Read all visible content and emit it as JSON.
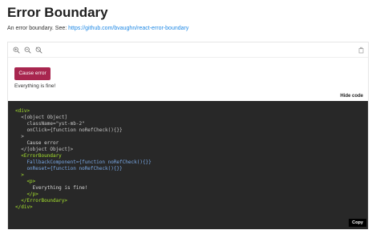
{
  "page": {
    "title": "Error Boundary",
    "description_prefix": "An error boundary. See:",
    "description_link": "https://github.com/bvaughn/react-error-boundary"
  },
  "toolbar": {
    "zoom_in_icon": "zoom-in-icon",
    "zoom_out_icon": "zoom-out-icon",
    "reset_zoom_icon": "zoom-reset-icon",
    "copy_icon": "copy-icon"
  },
  "preview": {
    "cause_error_label": "Cause error",
    "status_text": "Everything is fine!"
  },
  "code_panel": {
    "hide_code_label": "Hide code",
    "copy_label": "Copy",
    "lines": [
      "<div>",
      "  <[object Object]",
      "    className=\"yst-mb-2\"",
      "    onClick={function noRefCheck(){}}",
      "  >",
      "    Cause error",
      "  </[object Object]>",
      "  <ErrorBoundary",
      "    FallbackComponent={function noRefCheck(){}}",
      "    onReset={function noRefCheck(){}}",
      "  >",
      "    <p>",
      "      Everything is fine!",
      "    </p>",
      "  </ErrorBoundary>",
      "</div>"
    ]
  },
  "colors": {
    "button": "#a8264f",
    "link": "#1e88e5",
    "code_bg": "#282828"
  }
}
